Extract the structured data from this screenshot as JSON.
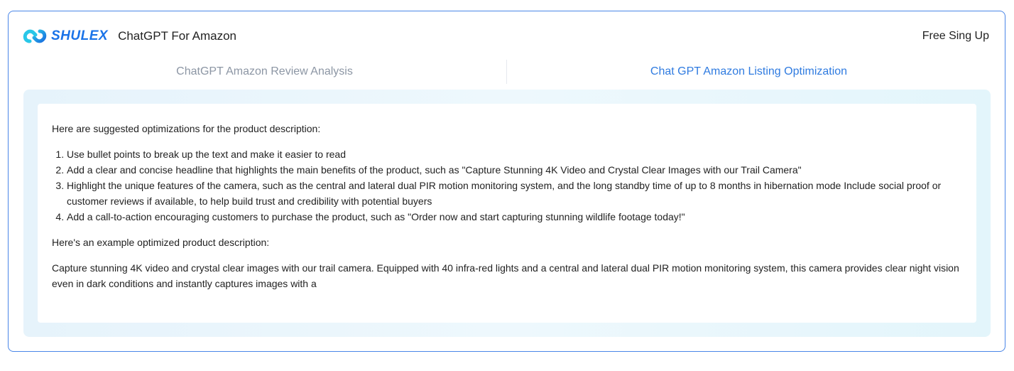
{
  "header": {
    "brand": "SHULEX",
    "app_title": "ChatGPT For Amazon",
    "signup_label": "Free Sing Up",
    "brand_color": "#1a73e8"
  },
  "tabs": [
    {
      "label": "ChatGPT Amazon Review Analysis",
      "active": false
    },
    {
      "label": "Chat GPT Amazon Listing Optimization",
      "active": true
    }
  ],
  "content": {
    "intro": "Here are suggested optimizations for the product description:",
    "suggestions": [
      "Use bullet points to break up the text and make it easier to read",
      "Add a clear and concise headline that highlights the main benefits of the product, such as \"Capture Stunning 4K Video and Crystal Clear Images with our Trail Camera\"",
      "Highlight the unique features of the camera, such as the central and lateral dual PIR motion monitoring system, and the long standby time of up to 8 months in hibernation mode Include social proof or customer reviews if available, to help build trust and credibility with potential buyers",
      "Add a call-to-action encouraging customers to purchase the product, such as \"Order now and start capturing stunning wildlife footage today!\""
    ],
    "example_heading": "Here's an example optimized product description:",
    "example_text": "Capture stunning 4K video and crystal clear images with our trail camera. Equipped with 40 infra-red lights and a central and lateral dual PIR motion monitoring system, this camera provides clear night vision even in dark conditions and instantly captures images with a"
  },
  "colors": {
    "accent": "#2f7be0",
    "frame_border": "#4a86e8",
    "inactive_tab": "#8c96a4",
    "panel_bg": "#e6f3fb"
  }
}
